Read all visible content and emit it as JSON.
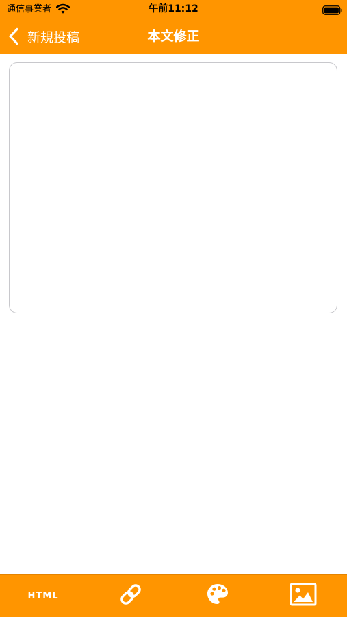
{
  "status_bar": {
    "carrier": "通信事業者",
    "time": "午前11:12",
    "wifi_icon": "wifi-icon",
    "battery_icon": "battery-icon"
  },
  "nav_bar": {
    "back_label": "新規投稿",
    "back_icon": "chevron-left-icon",
    "title": "本文修正"
  },
  "editor": {
    "value": "",
    "placeholder": ""
  },
  "toolbar": {
    "html_label": "HTML",
    "link_icon": "link-icon",
    "palette_icon": "palette-icon",
    "image_icon": "image-icon"
  },
  "colors": {
    "accent": "#FF9500",
    "on_accent": "#FFFFFF",
    "editor_border": "#C8C8CC"
  }
}
